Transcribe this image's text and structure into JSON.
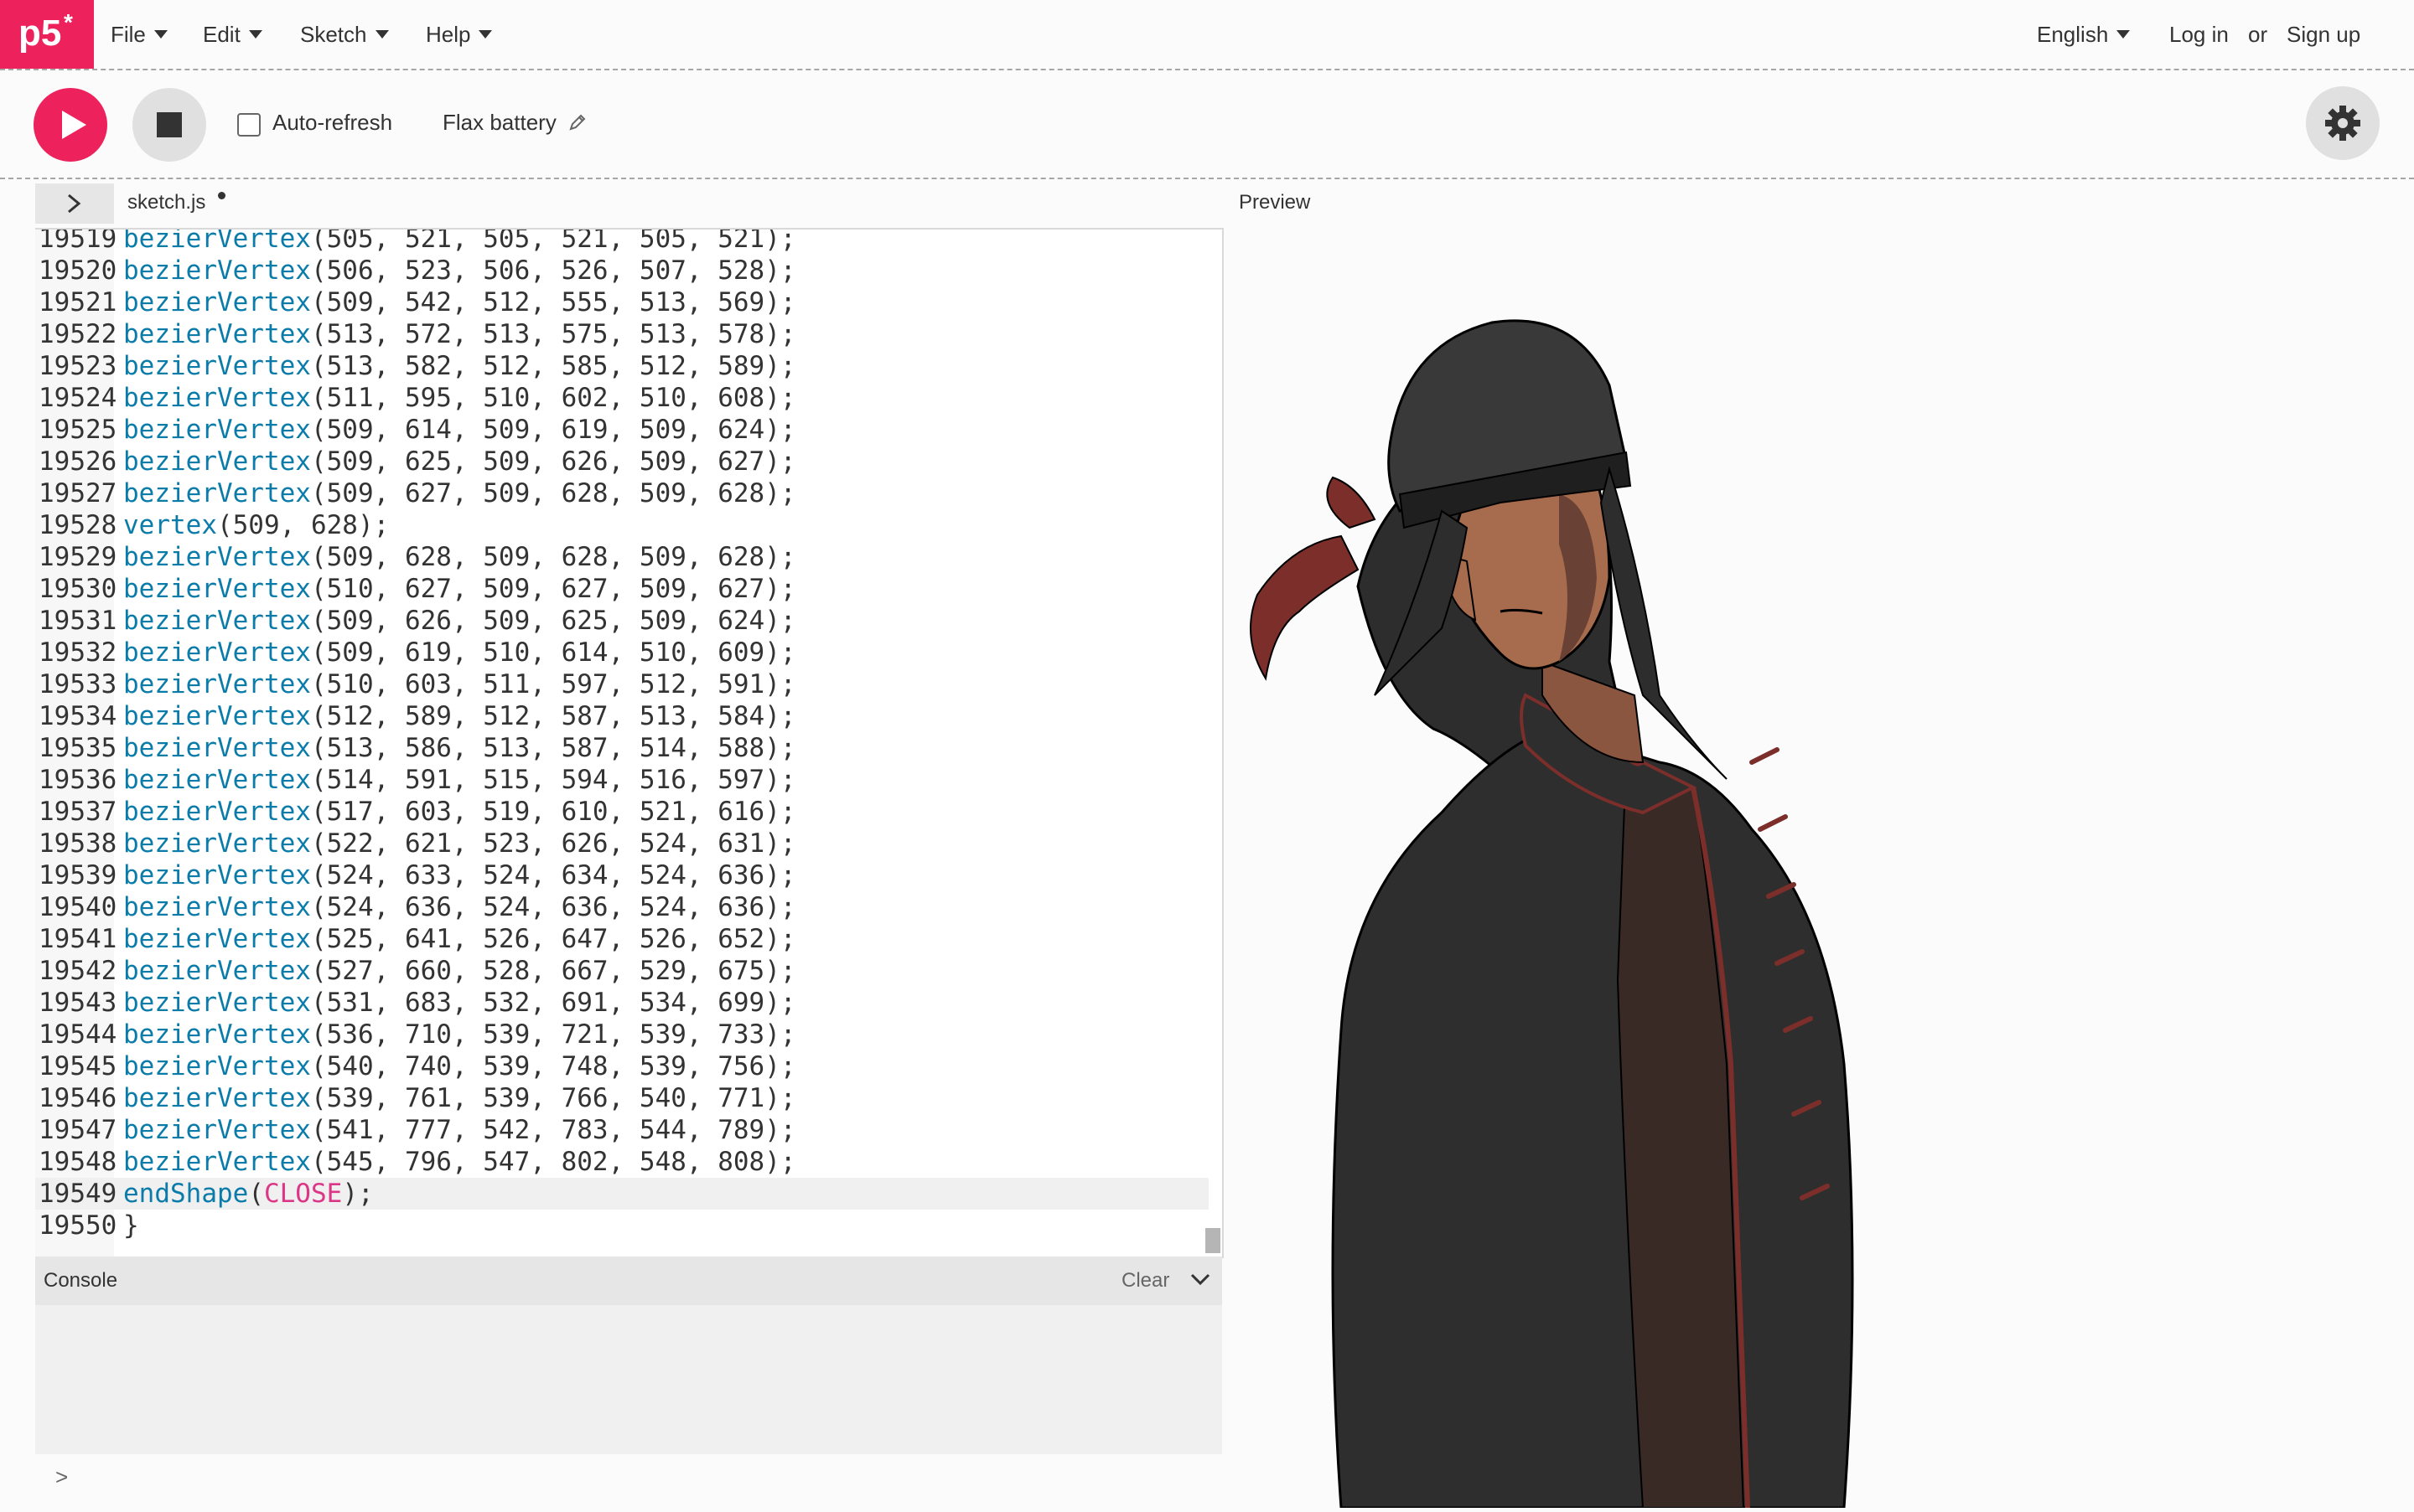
{
  "nav": {
    "logo_text": "p5*",
    "menus": [
      "File",
      "Edit",
      "Sketch",
      "Help"
    ],
    "language": "English",
    "login": "Log in",
    "or": "or",
    "signup": "Sign up"
  },
  "toolbar": {
    "autorefresh_label": "Auto-refresh",
    "autorefresh_checked": false,
    "sketch_name": "Flax battery"
  },
  "editor": {
    "file_name": "sketch.js",
    "unsaved": true,
    "lines": [
      {
        "n": "19519",
        "segments": [
          {
            "t": "bezierVertex",
            "c": "fn"
          },
          {
            "t": "(505, 521, 505, 521, 505, 521);"
          }
        ]
      },
      {
        "n": "19520",
        "segments": [
          {
            "t": "bezierVertex",
            "c": "fn"
          },
          {
            "t": "(506, 523, 506, 526, 507, 528);"
          }
        ]
      },
      {
        "n": "19521",
        "segments": [
          {
            "t": "bezierVertex",
            "c": "fn"
          },
          {
            "t": "(509, 542, 512, 555, 513, 569);"
          }
        ]
      },
      {
        "n": "19522",
        "segments": [
          {
            "t": "bezierVertex",
            "c": "fn"
          },
          {
            "t": "(513, 572, 513, 575, 513, 578);"
          }
        ]
      },
      {
        "n": "19523",
        "segments": [
          {
            "t": "bezierVertex",
            "c": "fn"
          },
          {
            "t": "(513, 582, 512, 585, 512, 589);"
          }
        ]
      },
      {
        "n": "19524",
        "segments": [
          {
            "t": "bezierVertex",
            "c": "fn"
          },
          {
            "t": "(511, 595, 510, 602, 510, 608);"
          }
        ]
      },
      {
        "n": "19525",
        "segments": [
          {
            "t": "bezierVertex",
            "c": "fn"
          },
          {
            "t": "(509, 614, 509, 619, 509, 624);"
          }
        ]
      },
      {
        "n": "19526",
        "segments": [
          {
            "t": "bezierVertex",
            "c": "fn"
          },
          {
            "t": "(509, 625, 509, 626, 509, 627);"
          }
        ]
      },
      {
        "n": "19527",
        "segments": [
          {
            "t": "bezierVertex",
            "c": "fn"
          },
          {
            "t": "(509, 627, 509, 628, 509, 628);"
          }
        ]
      },
      {
        "n": "19528",
        "segments": [
          {
            "t": "vertex",
            "c": "fn"
          },
          {
            "t": "(509, 628);"
          }
        ]
      },
      {
        "n": "19529",
        "segments": [
          {
            "t": "bezierVertex",
            "c": "fn"
          },
          {
            "t": "(509, 628, 509, 628, 509, 628);"
          }
        ]
      },
      {
        "n": "19530",
        "segments": [
          {
            "t": "bezierVertex",
            "c": "fn"
          },
          {
            "t": "(510, 627, 509, 627, 509, 627);"
          }
        ]
      },
      {
        "n": "19531",
        "segments": [
          {
            "t": "bezierVertex",
            "c": "fn"
          },
          {
            "t": "(509, 626, 509, 625, 509, 624);"
          }
        ]
      },
      {
        "n": "19532",
        "segments": [
          {
            "t": "bezierVertex",
            "c": "fn"
          },
          {
            "t": "(509, 619, 510, 614, 510, 609);"
          }
        ]
      },
      {
        "n": "19533",
        "segments": [
          {
            "t": "bezierVertex",
            "c": "fn"
          },
          {
            "t": "(510, 603, 511, 597, 512, 591);"
          }
        ]
      },
      {
        "n": "19534",
        "segments": [
          {
            "t": "bezierVertex",
            "c": "fn"
          },
          {
            "t": "(512, 589, 512, 587, 513, 584);"
          }
        ]
      },
      {
        "n": "19535",
        "segments": [
          {
            "t": "bezierVertex",
            "c": "fn"
          },
          {
            "t": "(513, 586, 513, 587, 514, 588);"
          }
        ]
      },
      {
        "n": "19536",
        "segments": [
          {
            "t": "bezierVertex",
            "c": "fn"
          },
          {
            "t": "(514, 591, 515, 594, 516, 597);"
          }
        ]
      },
      {
        "n": "19537",
        "segments": [
          {
            "t": "bezierVertex",
            "c": "fn"
          },
          {
            "t": "(517, 603, 519, 610, 521, 616);"
          }
        ]
      },
      {
        "n": "19538",
        "segments": [
          {
            "t": "bezierVertex",
            "c": "fn"
          },
          {
            "t": "(522, 621, 523, 626, 524, 631);"
          }
        ]
      },
      {
        "n": "19539",
        "segments": [
          {
            "t": "bezierVertex",
            "c": "fn"
          },
          {
            "t": "(524, 633, 524, 634, 524, 636);"
          }
        ]
      },
      {
        "n": "19540",
        "segments": [
          {
            "t": "bezierVertex",
            "c": "fn"
          },
          {
            "t": "(524, 636, 524, 636, 524, 636);"
          }
        ]
      },
      {
        "n": "19541",
        "segments": [
          {
            "t": "bezierVertex",
            "c": "fn"
          },
          {
            "t": "(525, 641, 526, 647, 526, 652);"
          }
        ]
      },
      {
        "n": "19542",
        "segments": [
          {
            "t": "bezierVertex",
            "c": "fn"
          },
          {
            "t": "(527, 660, 528, 667, 529, 675);"
          }
        ]
      },
      {
        "n": "19543",
        "segments": [
          {
            "t": "bezierVertex",
            "c": "fn"
          },
          {
            "t": "(531, 683, 532, 691, 534, 699);"
          }
        ]
      },
      {
        "n": "19544",
        "segments": [
          {
            "t": "bezierVertex",
            "c": "fn"
          },
          {
            "t": "(536, 710, 539, 721, 539, 733);"
          }
        ]
      },
      {
        "n": "19545",
        "segments": [
          {
            "t": "bezierVertex",
            "c": "fn"
          },
          {
            "t": "(540, 740, 539, 748, 539, 756);"
          }
        ]
      },
      {
        "n": "19546",
        "segments": [
          {
            "t": "bezierVertex",
            "c": "fn"
          },
          {
            "t": "(539, 761, 539, 766, 540, 771);"
          }
        ]
      },
      {
        "n": "19547",
        "segments": [
          {
            "t": "bezierVertex",
            "c": "fn"
          },
          {
            "t": "(541, 777, 542, 783, 544, 789);"
          }
        ]
      },
      {
        "n": "19548",
        "segments": [
          {
            "t": "bezierVertex",
            "c": "fn"
          },
          {
            "t": "(545, 796, 547, 802, 548, 808);"
          }
        ]
      },
      {
        "n": "19549",
        "active": true,
        "segments": [
          {
            "t": "endShape",
            "c": "fn"
          },
          {
            "t": "("
          },
          {
            "t": "CLOSE",
            "c": "kw"
          },
          {
            "t": ");"
          }
        ]
      },
      {
        "n": "19550",
        "segments": [
          {
            "t": "}"
          }
        ]
      }
    ]
  },
  "console": {
    "label": "Console",
    "clear": "Clear",
    "prompt": ">"
  },
  "preview": {
    "label": "Preview"
  },
  "colors": {
    "accent": "#ed225d",
    "function": "#0b7ca9",
    "keyword": "#dc3787",
    "coat": "#2e2e2e",
    "skin": "#a76b4d",
    "trim": "#7b2e2a"
  }
}
